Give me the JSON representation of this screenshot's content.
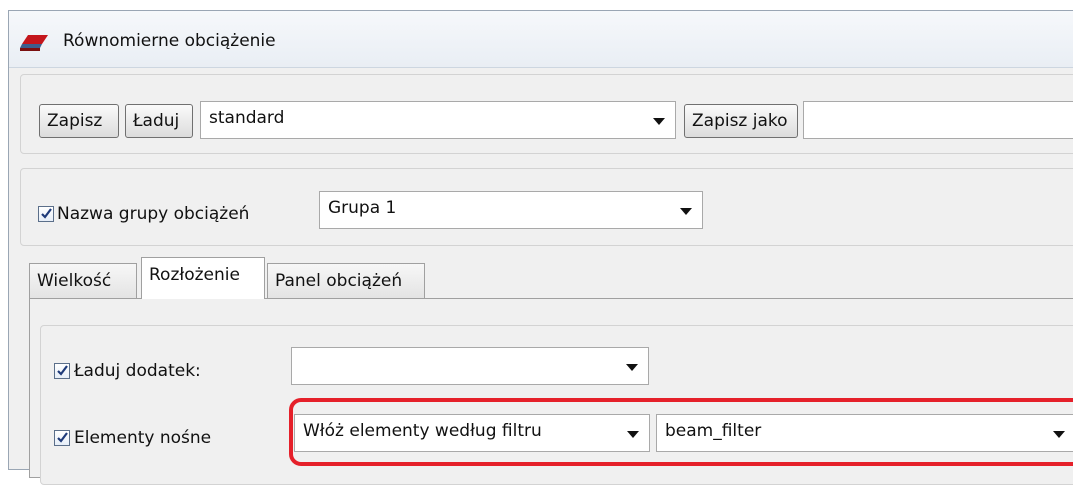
{
  "window": {
    "title": "Równomierne obciążenie",
    "icon": "load-app-icon",
    "accent": "#e5202a"
  },
  "toolbar": {
    "save_label": "Zapisz",
    "load_label": "Ładuj",
    "preset_value": "standard",
    "save_as_label": "Zapisz jako",
    "save_as_name": ""
  },
  "group": {
    "checked": true,
    "label": "Nazwa grupy obciążeń",
    "value": "Grupa 1"
  },
  "tabs": [
    {
      "label": "Wielkość",
      "active": false
    },
    {
      "label": "Rozłożenie",
      "active": true
    },
    {
      "label": "Panel obciążeń",
      "active": false
    }
  ],
  "distribution": {
    "load_addon": {
      "checked": true,
      "label": "Ładuj dodatek:",
      "value": ""
    },
    "bearing_elements": {
      "checked": true,
      "label": "Elementy nośne",
      "mode_value": "Włóż elementy według filtru",
      "filter_value": "beam_filter"
    }
  }
}
